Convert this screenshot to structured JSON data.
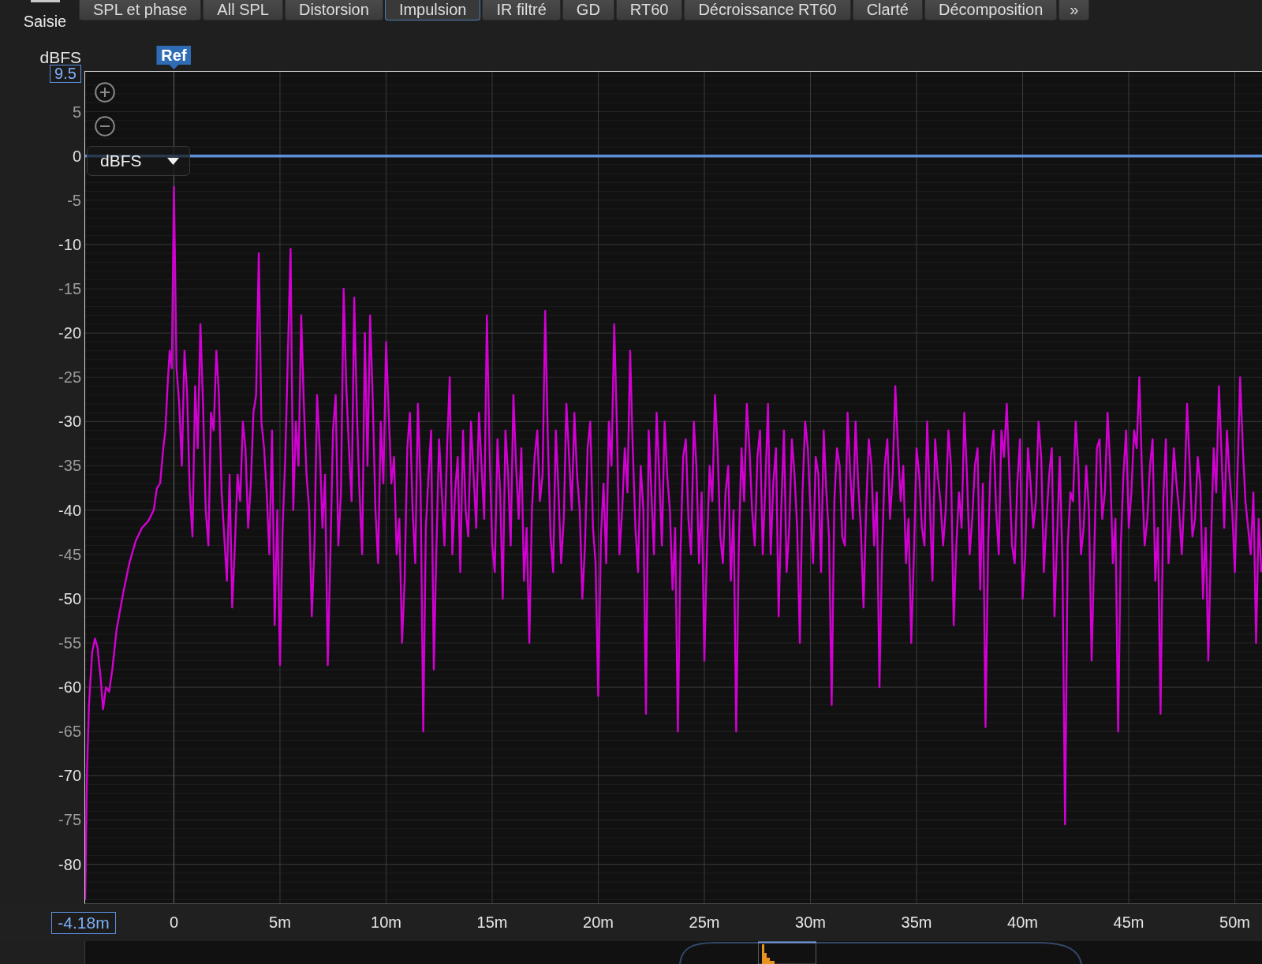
{
  "capture_button": {
    "label": "Saisie"
  },
  "tabs": [
    {
      "label": "SPL et phase",
      "selected": false
    },
    {
      "label": "All SPL",
      "selected": false
    },
    {
      "label": "Distorsion",
      "selected": false
    },
    {
      "label": "Impulsion",
      "selected": true
    },
    {
      "label": "IR filtré",
      "selected": false
    },
    {
      "label": "GD",
      "selected": false
    },
    {
      "label": "RT60",
      "selected": false
    },
    {
      "label": "Décroissance RT60",
      "selected": false
    },
    {
      "label": "Clarté",
      "selected": false
    },
    {
      "label": "Décomposition",
      "selected": false
    }
  ],
  "more_tabs": {
    "label": "»"
  },
  "plot": {
    "y_max": "9.5",
    "x_min": "-4.18m",
    "unit_select": "dBFS",
    "chart_data": {
      "type": "line",
      "ylabel": "dBFS",
      "grid": true,
      "xlim": [
        -4.18,
        51.28
      ],
      "ylim": [
        -84.4,
        9.5
      ],
      "xticks": [
        {
          "value": 0,
          "label": "0"
        },
        {
          "value": 5,
          "label": "5m"
        },
        {
          "value": 10,
          "label": "10m"
        },
        {
          "value": 15,
          "label": "15m"
        },
        {
          "value": 20,
          "label": "20m"
        },
        {
          "value": 25,
          "label": "25m"
        },
        {
          "value": 30,
          "label": "30m"
        },
        {
          "value": 35,
          "label": "35m"
        },
        {
          "value": 40,
          "label": "40m"
        },
        {
          "value": 45,
          "label": "45m"
        },
        {
          "value": 50,
          "label": "50m"
        }
      ],
      "yticks": [
        5,
        0,
        -5,
        -10,
        -15,
        -20,
        -25,
        -30,
        -35,
        -40,
        -45,
        -50,
        -55,
        -60,
        -65,
        -70,
        -75,
        -80
      ],
      "ref_lines": [
        {
          "axis": "y",
          "value": 0
        },
        {
          "axis": "x",
          "value": 0,
          "label": "Ref"
        }
      ],
      "x": [
        -4.18,
        -4.1,
        -4,
        -3.85,
        -3.72,
        -3.6,
        -3.45,
        -3.34,
        -3.2,
        -3.05,
        -2.9,
        -2.7,
        -2.4,
        -2.1,
        -1.8,
        -1.5,
        -1.2,
        -0.95,
        -0.8,
        -0.65,
        -0.5,
        -0.4,
        -0.3,
        -0.2,
        -0.1,
        0,
        0.125,
        0.25,
        0.375,
        0.5,
        0.625,
        0.75,
        0.875,
        1,
        1.125,
        1.25,
        1.375,
        1.5,
        1.625,
        1.75,
        1.875,
        2,
        2.125,
        2.25,
        2.375,
        2.5,
        2.625,
        2.75,
        2.875,
        3,
        3.125,
        3.25,
        3.375,
        3.5,
        3.625,
        3.75,
        3.875,
        4,
        4.125,
        4.25,
        4.375,
        4.5,
        4.625,
        4.75,
        4.875,
        5,
        5.125,
        5.25,
        5.375,
        5.5,
        5.625,
        5.75,
        5.875,
        6,
        6.125,
        6.25,
        6.375,
        6.5,
        6.625,
        6.75,
        6.875,
        7,
        7.125,
        7.25,
        7.375,
        7.5,
        7.625,
        7.75,
        7.875,
        8,
        8.125,
        8.25,
        8.375,
        8.5,
        8.625,
        8.75,
        8.875,
        9,
        9.125,
        9.25,
        9.375,
        9.5,
        9.625,
        9.75,
        9.875,
        10,
        10.125,
        10.25,
        10.375,
        10.5,
        10.625,
        10.75,
        10.875,
        11,
        11.125,
        11.25,
        11.375,
        11.5,
        11.625,
        11.75,
        11.875,
        12,
        12.125,
        12.25,
        12.375,
        12.5,
        12.625,
        12.75,
        12.875,
        13,
        13.125,
        13.25,
        13.375,
        13.5,
        13.625,
        13.75,
        13.875,
        14,
        14.125,
        14.25,
        14.375,
        14.5,
        14.625,
        14.75,
        14.875,
        15,
        15.125,
        15.25,
        15.375,
        15.5,
        15.625,
        15.75,
        15.875,
        16,
        16.125,
        16.25,
        16.375,
        16.5,
        16.625,
        16.75,
        16.875,
        17,
        17.125,
        17.25,
        17.375,
        17.5,
        17.625,
        17.75,
        17.875,
        18,
        18.125,
        18.25,
        18.375,
        18.5,
        18.625,
        18.75,
        18.875,
        19,
        19.125,
        19.25,
        19.375,
        19.5,
        19.625,
        19.75,
        19.875,
        20,
        20.125,
        20.25,
        20.375,
        20.5,
        20.625,
        20.75,
        20.875,
        21,
        21.125,
        21.25,
        21.375,
        21.5,
        21.625,
        21.75,
        21.875,
        22,
        22.125,
        22.25,
        22.375,
        22.5,
        22.625,
        22.75,
        22.875,
        23,
        23.125,
        23.25,
        23.375,
        23.5,
        23.625,
        23.75,
        23.875,
        24,
        24.125,
        24.25,
        24.375,
        24.5,
        24.625,
        24.75,
        24.875,
        25,
        25.125,
        25.25,
        25.375,
        25.5,
        25.625,
        25.75,
        25.875,
        26,
        26.125,
        26.25,
        26.375,
        26.5,
        26.625,
        26.75,
        26.875,
        27,
        27.125,
        27.25,
        27.375,
        27.5,
        27.625,
        27.75,
        27.875,
        28,
        28.125,
        28.25,
        28.375,
        28.5,
        28.625,
        28.75,
        28.875,
        29,
        29.125,
        29.25,
        29.375,
        29.5,
        29.625,
        29.75,
        29.875,
        30,
        30.125,
        30.25,
        30.375,
        30.5,
        30.625,
        30.75,
        30.875,
        31,
        31.125,
        31.25,
        31.375,
        31.5,
        31.625,
        31.75,
        31.875,
        32,
        32.125,
        32.25,
        32.375,
        32.5,
        32.625,
        32.75,
        32.875,
        33,
        33.125,
        33.25,
        33.375,
        33.5,
        33.625,
        33.75,
        33.875,
        34,
        34.125,
        34.25,
        34.375,
        34.5,
        34.625,
        34.75,
        34.875,
        35,
        35.125,
        35.25,
        35.375,
        35.5,
        35.625,
        35.75,
        35.875,
        36,
        36.125,
        36.25,
        36.375,
        36.5,
        36.625,
        36.75,
        36.875,
        37,
        37.125,
        37.25,
        37.375,
        37.5,
        37.625,
        37.75,
        37.875,
        38,
        38.125,
        38.25,
        38.375,
        38.5,
        38.625,
        38.75,
        38.875,
        39,
        39.125,
        39.25,
        39.375,
        39.5,
        39.625,
        39.75,
        39.875,
        40,
        40.125,
        40.25,
        40.375,
        40.5,
        40.625,
        40.75,
        40.875,
        41,
        41.125,
        41.25,
        41.375,
        41.5,
        41.625,
        41.75,
        41.875,
        42,
        42.125,
        42.25,
        42.375,
        42.5,
        42.625,
        42.75,
        42.875,
        43,
        43.125,
        43.25,
        43.375,
        43.5,
        43.625,
        43.75,
        43.875,
        44,
        44.125,
        44.25,
        44.375,
        44.5,
        44.625,
        44.75,
        44.875,
        45,
        45.125,
        45.25,
        45.375,
        45.5,
        45.625,
        45.75,
        45.875,
        46,
        46.125,
        46.25,
        46.375,
        46.5,
        46.625,
        46.75,
        46.875,
        47,
        47.125,
        47.25,
        47.375,
        47.5,
        47.625,
        47.75,
        47.875,
        48,
        48.125,
        48.25,
        48.375,
        48.5,
        48.625,
        48.75,
        48.875,
        49,
        49.125,
        49.25,
        49.375,
        49.5,
        49.625,
        49.75,
        49.875,
        50,
        50.125,
        50.25,
        50.375,
        50.5,
        50.625,
        50.75,
        50.875,
        51,
        51.125,
        51.25
      ],
      "series": [
        {
          "color": "#d200d2",
          "values": [
            -84,
            -70,
            -62,
            -56,
            -54.5,
            -55.5,
            -59,
            -62.5,
            -60,
            -60.5,
            -58,
            -53.5,
            -49.5,
            -46,
            -43.5,
            -42,
            -41.2,
            -40,
            -37.5,
            -37,
            -33,
            -31,
            -26,
            -22,
            -24,
            -3.5,
            -24,
            -28,
            -35,
            -22,
            -27,
            -38,
            -43,
            -26,
            -33,
            -19,
            -28,
            -40,
            -44,
            -29,
            -31,
            -22,
            -27,
            -38,
            -43,
            -48,
            -36,
            -51,
            -44,
            -36,
            -39,
            -30,
            -33,
            -42,
            -37,
            -29,
            -27,
            -11,
            -30,
            -33,
            -38,
            -45,
            -31,
            -53,
            -40,
            -57.5,
            -42,
            -34,
            -22,
            -10.5,
            -40,
            -30,
            -35,
            -18,
            -28,
            -36,
            -40,
            -52,
            -44,
            -27,
            -33,
            -42,
            -36,
            -57.5,
            -45,
            -31,
            -27,
            -44,
            -38,
            -15,
            -26,
            -33,
            -39,
            -16,
            -29,
            -38,
            -45,
            -20,
            -35,
            -18,
            -28,
            -40,
            -46,
            -30,
            -37,
            -21,
            -29,
            -37,
            -34,
            -45,
            -41,
            -55,
            -48,
            -33,
            -29,
            -40,
            -46,
            -28,
            -37,
            -65,
            -42,
            -36,
            -31,
            -58,
            -44,
            -32,
            -38,
            -44,
            -33,
            -25,
            -45,
            -38,
            -34,
            -47,
            -31,
            -40,
            -43,
            -30,
            -36,
            -42,
            -29,
            -35,
            -41,
            -18,
            -33,
            -44,
            -47,
            -32,
            -38,
            -50,
            -31,
            -36,
            -44,
            -27,
            -35,
            -41,
            -33,
            -48,
            -42,
            -55,
            -40,
            -34,
            -31,
            -39,
            -36,
            -17.5,
            -32,
            -43,
            -47,
            -31,
            -38,
            -46,
            -41,
            -28,
            -34,
            -40,
            -29,
            -36,
            -40,
            -50,
            -44,
            -33,
            -30,
            -42,
            -46,
            -61,
            -43,
            -37,
            -46,
            -30,
            -35,
            -19,
            -30,
            -45,
            -40,
            -33,
            -38,
            -22,
            -33,
            -42,
            -47,
            -35,
            -40,
            -63,
            -31,
            -38,
            -45,
            -29,
            -36,
            -44,
            -30,
            -36,
            -40,
            -49,
            -42,
            -65,
            -45,
            -34,
            -32,
            -41,
            -45,
            -30,
            -35,
            -46,
            -38,
            -57,
            -44,
            -35,
            -39,
            -27,
            -33,
            -43,
            -46,
            -38,
            -35,
            -48,
            -40,
            -65,
            -44,
            -33,
            -39,
            -28,
            -33,
            -40,
            -44,
            -34,
            -31,
            -45,
            -37,
            -28,
            -45,
            -37,
            -33,
            -52,
            -40,
            -31,
            -47,
            -42,
            -32,
            -36,
            -42,
            -55,
            -38,
            -30,
            -33,
            -40,
            -46,
            -34,
            -36,
            -47,
            -31,
            -38,
            -43,
            -62,
            -39,
            -33,
            -35,
            -43,
            -44,
            -29,
            -36,
            -41,
            -30,
            -37,
            -42,
            -51,
            -40,
            -32,
            -35,
            -44,
            -38,
            -60,
            -45,
            -35,
            -32,
            -41,
            -36,
            -26,
            -33,
            -39,
            -35,
            -46,
            -41,
            -55,
            -45,
            -33,
            -36,
            -42,
            -44,
            -30,
            -39,
            -48,
            -32,
            -36,
            -39,
            -44,
            -40,
            -31,
            -35,
            -53,
            -44,
            -38,
            -42,
            -29,
            -36,
            -45,
            -41,
            -35,
            -33,
            -49,
            -37,
            -64.5,
            -44,
            -34,
            -31,
            -40,
            -45,
            -31,
            -34,
            -28,
            -36,
            -44,
            -46,
            -37,
            -32,
            -50,
            -45,
            -33,
            -37,
            -42,
            -39,
            -30,
            -34,
            -47,
            -41,
            -36,
            -33,
            -52,
            -43,
            -34,
            -46,
            -75.5,
            -44,
            -38,
            -39,
            -30,
            -35,
            -45,
            -42,
            -35,
            -40,
            -57,
            -45,
            -33,
            -32,
            -41,
            -38,
            -29,
            -35,
            -46,
            -41,
            -65,
            -44,
            -36,
            -31,
            -42,
            -38,
            -31,
            -33,
            -25,
            -36,
            -44,
            -41,
            -35,
            -32,
            -48,
            -42,
            -63,
            -39,
            -32,
            -46,
            -40,
            -33,
            -37,
            -40,
            -45,
            -38,
            -28,
            -35,
            -43,
            -41,
            -34,
            -37,
            -50,
            -42,
            -57,
            -44,
            -33,
            -38,
            -26,
            -34,
            -42,
            -31,
            -36,
            -40,
            -47,
            -36,
            -25,
            -33,
            -39,
            -42,
            -45,
            -38,
            -55,
            -41,
            -47
          ]
        }
      ]
    }
  }
}
